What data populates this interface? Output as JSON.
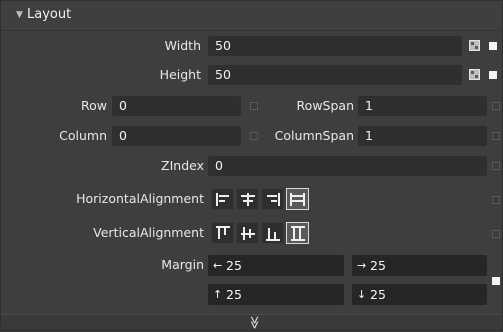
{
  "section": {
    "title": "Layout",
    "expanded": true
  },
  "width": {
    "label": "Width",
    "value": "50"
  },
  "height": {
    "label": "Height",
    "value": "50"
  },
  "row": {
    "label": "Row",
    "value": "0"
  },
  "rowspan": {
    "label": "RowSpan",
    "value": "1"
  },
  "column": {
    "label": "Column",
    "value": "0"
  },
  "columnspan": {
    "label": "ColumnSpan",
    "value": "1"
  },
  "zindex": {
    "label": "ZIndex",
    "value": "0"
  },
  "halign": {
    "label": "HorizontalAlignment",
    "options": [
      "align-left-icon",
      "align-center-icon",
      "align-right-icon",
      "align-stretch-icon"
    ],
    "selected": "Stretch"
  },
  "valign": {
    "label": "VerticalAlignment",
    "options": [
      "align-top-icon",
      "align-middle-icon",
      "align-bottom-icon",
      "align-stretch-vertical-icon"
    ],
    "selected": "Stretch"
  },
  "margin": {
    "label": "Margin",
    "left": "25",
    "right": "25",
    "top": "25",
    "bottom": "25",
    "arrows": {
      "left": "←",
      "right": "→",
      "top": "↑",
      "bottom": "↓"
    }
  },
  "footer": {
    "expand_glyph": "≫"
  },
  "colors": {
    "panel_bg": "#3e3e3e",
    "field_bg": "#2f2f2f",
    "text": "#e8e8e8",
    "selected_border": "#d8d8d8"
  }
}
